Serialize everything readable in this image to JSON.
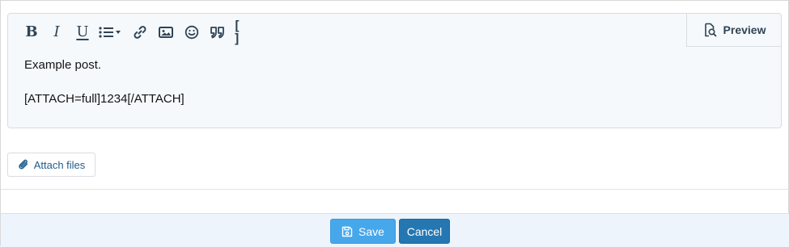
{
  "editor": {
    "toolbar": {
      "bold_label": "B",
      "italic_label": "I",
      "underline_label": "U",
      "code_label": "[ ]",
      "icons": [
        "bold-icon",
        "italic-icon",
        "underline-icon",
        "list-icon",
        "link-icon",
        "image-icon",
        "smiley-icon",
        "quote-icon",
        "code-icon"
      ]
    },
    "preview_label": "Preview",
    "content_lines": [
      "Example post.",
      "[ATTACH=full]1234[/ATTACH]"
    ]
  },
  "attach_files_label": "Attach files",
  "footer": {
    "save_label": "Save",
    "cancel_label": "Cancel"
  },
  "colors": {
    "accent": "#47a7eb",
    "primary_dark": "#2577b1",
    "toolbar_icon": "#2f4455",
    "footer_bg": "#edf4fb"
  }
}
